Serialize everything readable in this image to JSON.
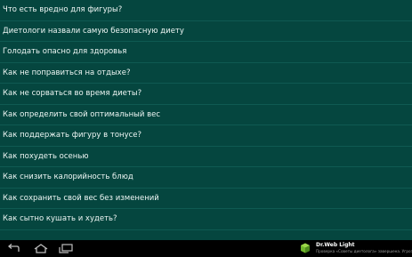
{
  "articles": [
    "Что есть вредно для фигуры?",
    "Диетологи назвали самую безопасную диету",
    "Голодать опасно для здоровья",
    "Как не поправиться на отдыхе?",
    "Как не сорваться во время диеты?",
    "Как определить свой оптимальный вес",
    "Как поддержать фигуру в тонусе?",
    "Как похудеть осенью",
    "Как снизить калорийность блюд",
    "Как сохранить свой вес без изменений",
    "Как сытно кушать и худеть?"
  ],
  "notification": {
    "title": "Dr.Web Light",
    "text": "Проверка «Советы диетолога» завершена. Угроз н"
  },
  "colors": {
    "list_background": "#05463f",
    "divider": "#0f5a52",
    "text": "#eef6f4",
    "navbar": "#000000"
  },
  "icons": {
    "nav": [
      "back-icon",
      "home-icon",
      "recent-apps-icon"
    ],
    "notification": "drweb-app-icon"
  }
}
